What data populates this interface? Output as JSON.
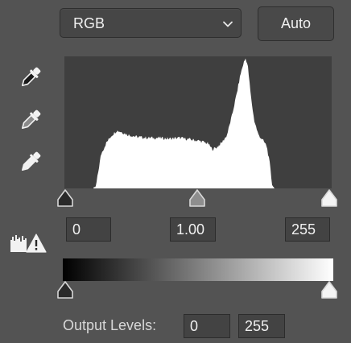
{
  "channel": {
    "selected": "RGB"
  },
  "auto_label": "Auto",
  "eyedroppers": [
    {
      "icon": "black-eyedropper-icon"
    },
    {
      "icon": "gray-eyedropper-icon"
    },
    {
      "icon": "white-eyedropper-icon"
    }
  ],
  "input_levels": {
    "shadows": "0",
    "midtones": "1.00",
    "highlights": "255"
  },
  "output_levels": {
    "label": "Output Levels:",
    "low": "0",
    "high": "255"
  },
  "histogram_profile": [
    {
      "level": 0,
      "count": 0
    },
    {
      "level": 28,
      "count": 0
    },
    {
      "level": 30,
      "count": 2
    },
    {
      "level": 32,
      "count": 18
    },
    {
      "level": 35,
      "count": 42
    },
    {
      "level": 40,
      "count": 56
    },
    {
      "level": 45,
      "count": 65
    },
    {
      "level": 50,
      "count": 71
    },
    {
      "level": 55,
      "count": 69
    },
    {
      "level": 60,
      "count": 66
    },
    {
      "level": 70,
      "count": 63
    },
    {
      "level": 80,
      "count": 62
    },
    {
      "level": 90,
      "count": 62
    },
    {
      "level": 100,
      "count": 61
    },
    {
      "level": 110,
      "count": 62
    },
    {
      "level": 120,
      "count": 60
    },
    {
      "level": 130,
      "count": 58
    },
    {
      "level": 137,
      "count": 55
    },
    {
      "level": 141,
      "count": 48
    },
    {
      "level": 145,
      "count": 50
    },
    {
      "level": 150,
      "count": 56
    },
    {
      "level": 155,
      "count": 65
    },
    {
      "level": 160,
      "count": 90
    },
    {
      "level": 165,
      "count": 120
    },
    {
      "level": 168,
      "count": 140
    },
    {
      "level": 171,
      "count": 154
    },
    {
      "level": 173,
      "count": 160
    },
    {
      "level": 175,
      "count": 150
    },
    {
      "level": 178,
      "count": 112
    },
    {
      "level": 181,
      "count": 84
    },
    {
      "level": 185,
      "count": 66
    },
    {
      "level": 190,
      "count": 58
    },
    {
      "level": 193,
      "count": 52
    },
    {
      "level": 196,
      "count": 30
    },
    {
      "level": 198,
      "count": 6
    },
    {
      "level": 200,
      "count": 0
    },
    {
      "level": 255,
      "count": 0
    }
  ],
  "colors": {
    "panel_bg": "#535353",
    "histogram_bg": "#3f3f3f",
    "histogram_fill": "#ffffff"
  }
}
